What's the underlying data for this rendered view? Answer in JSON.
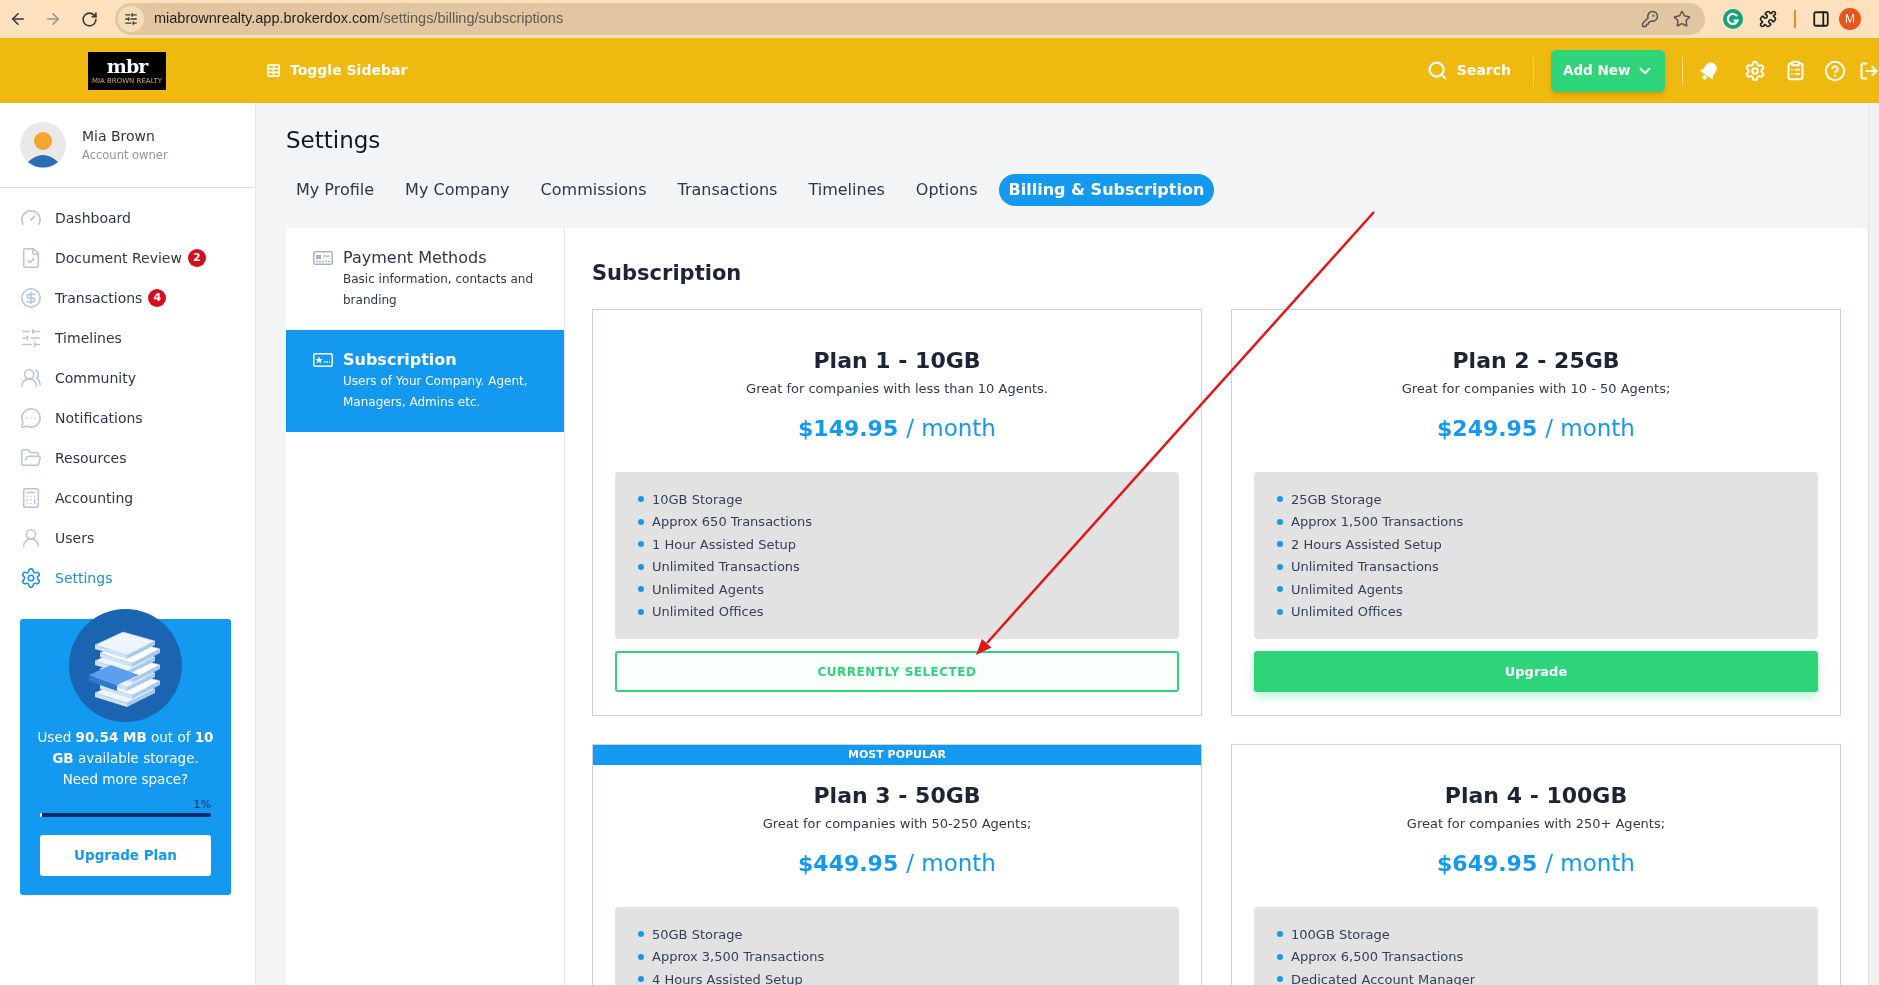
{
  "browser": {
    "url_host": "miabrownrealty.app.brokerdox.com",
    "url_path": "/settings/billing/subscriptions",
    "profile_initial": "M"
  },
  "header": {
    "logo": "mbr",
    "logo_tagline": "MIA BROWN REALTY",
    "toggle_label": "Toggle Sidebar",
    "search_label": "Search",
    "add_button": "Add New"
  },
  "sidebar": {
    "user": {
      "name": "Mia Brown",
      "role": "Account owner"
    },
    "items": [
      {
        "label": "Dashboard",
        "selected": false
      },
      {
        "label": "Document Review",
        "badge": "2",
        "selected": false
      },
      {
        "label": "Transactions",
        "badge": "4",
        "selected": false
      },
      {
        "label": "Timelines",
        "selected": false
      },
      {
        "label": "Community",
        "selected": false
      },
      {
        "label": "Notifications",
        "selected": false
      },
      {
        "label": "Resources",
        "selected": false
      },
      {
        "label": "Accounting",
        "selected": false
      },
      {
        "label": "Users",
        "selected": false
      },
      {
        "label": "Settings",
        "selected": true
      }
    ],
    "storage": {
      "message": "Used **90.54 MB** out of **10 GB** available storage. Need more space?",
      "percent": "1%",
      "level": 0.01,
      "button": "Upgrade Plan"
    }
  },
  "page": {
    "title": "Settings"
  },
  "tabs": [
    {
      "label": "My Profile",
      "selected": false
    },
    {
      "label": "My Company",
      "selected": false
    },
    {
      "label": "Commissions",
      "selected": false
    },
    {
      "label": "Transactions",
      "selected": false
    },
    {
      "label": "Timelines",
      "selected": false
    },
    {
      "label": "Options",
      "selected": false
    },
    {
      "label": "Billing & Subscription",
      "selected": true
    }
  ],
  "settings_menu": [
    {
      "title": "Payment Methods",
      "description": "Basic information, contacts and branding",
      "selected": false
    },
    {
      "title": "Subscription",
      "description": "Users of Your Company. Agent, Managers, Admins etc.",
      "selected": true
    }
  ],
  "section": {
    "title": "Subscription"
  },
  "plans": [
    {
      "title": "Plan 1 - 10GB",
      "subtitle": "Great for companies with less than 10 Agents.",
      "price": "$149.95",
      "period": "/ month",
      "features": [
        "10GB Storage",
        "Approx 650 Transactions",
        "1 Hour Assisted Setup",
        "Unlimited Transactions",
        "Unlimited Agents",
        "Unlimited Offices"
      ],
      "button": "CURRENTLY SELECTED",
      "selected": true
    },
    {
      "title": "Plan 2 - 25GB",
      "subtitle": "Great for companies with 10 - 50 Agents;",
      "price": "$249.95",
      "period": "/ month",
      "features": [
        "25GB Storage",
        "Approx 1,500 Transactions",
        "2 Hours Assisted Setup",
        "Unlimited Transactions",
        "Unlimited Agents",
        "Unlimited Offices"
      ],
      "button": "Upgrade",
      "selected": false
    },
    {
      "ribbon": "MOST POPULAR",
      "title": "Plan 3 - 50GB",
      "subtitle": "Great for companies with 50-250 Agents;",
      "price": "$449.95",
      "period": "/ month",
      "features": [
        "50GB Storage",
        "Approx 3,500 Transactions",
        "4 Hours Assisted Setup"
      ]
    },
    {
      "title": "Plan 4 - 100GB",
      "subtitle": "Great for companies with 250+ Agents;",
      "price": "$649.95",
      "period": "/ month",
      "features": [
        "100GB Storage",
        "Approx 6,500 Transactions",
        "Dedicated Account Manager"
      ]
    }
  ]
}
